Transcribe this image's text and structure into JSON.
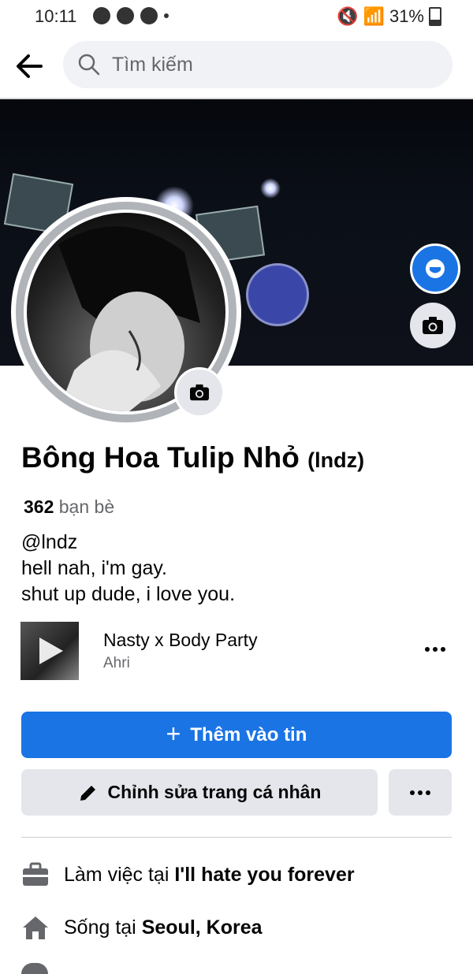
{
  "status_bar": {
    "time": "10:11",
    "battery": "31%"
  },
  "search": {
    "placeholder": "Tìm kiếm"
  },
  "profile": {
    "name": "Bông Hoa Tulip Nhỏ",
    "alt_name": "(lndz)",
    "friends_count": "362",
    "friends_label": "bạn bè",
    "bio": [
      "@lndz",
      "hell nah, i'm gay.",
      "shut up dude, i love you."
    ]
  },
  "music": {
    "title": "Nasty x Body Party",
    "artist": "Ahri"
  },
  "buttons": {
    "add_story": "Thêm vào tin",
    "edit_profile": "Chỉnh sửa trang cá nhân"
  },
  "details": {
    "work_prefix": "Làm việc tại",
    "work_place": "I'll hate you forever",
    "live_prefix": "Sống tại",
    "live_place": "Seoul, Korea"
  },
  "colors": {
    "primary": "#1b74e4",
    "secondary_bg": "#e4e6eb",
    "muted_text": "#65676b"
  },
  "icons": [
    "back-arrow-icon",
    "search-icon",
    "camera-icon",
    "avatar-badge-icon",
    "play-icon",
    "plus-icon",
    "pencil-icon",
    "more-icon",
    "briefcase-icon",
    "home-icon"
  ]
}
